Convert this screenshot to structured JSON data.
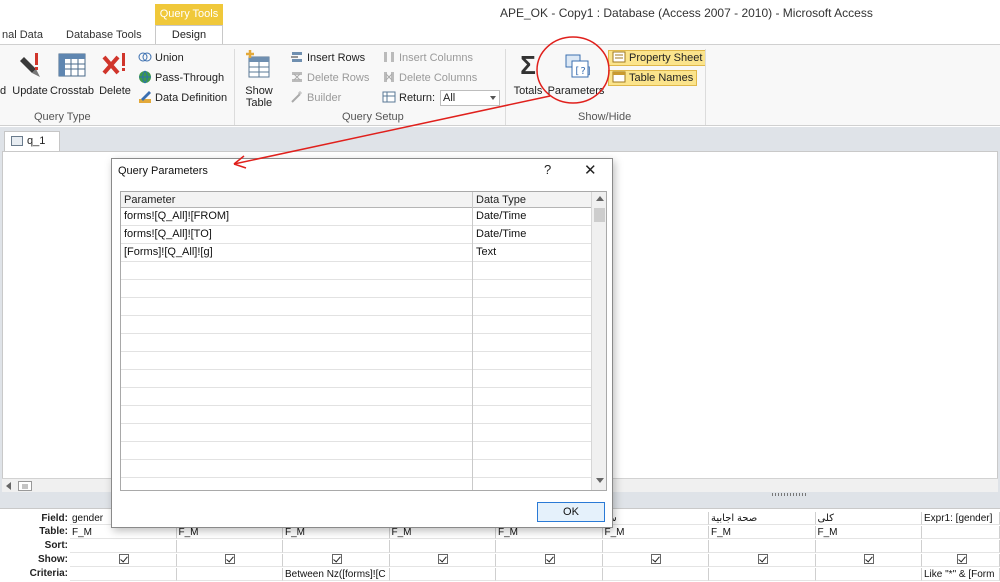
{
  "window": {
    "title": "APE_OK - Copy1 : Database (Access 2007 - 2010)  -  Microsoft Access"
  },
  "ribbon_tabs": {
    "context_label": "Query Tools",
    "external": "nal Data",
    "dbtools": "Database Tools",
    "design": "Design"
  },
  "ribbon": {
    "query_type": {
      "label": "Query Type",
      "update": "Update",
      "crosstab": "Crosstab",
      "delete": "Delete",
      "partial_left": "d",
      "union": "Union",
      "pass_through": "Pass-Through",
      "data_definition": "Data Definition"
    },
    "query_setup": {
      "label": "Query Setup",
      "show_table": [
        "Show",
        "Table"
      ],
      "insert_rows": "Insert Rows",
      "delete_rows": "Delete Rows",
      "builder": "Builder",
      "insert_columns": "Insert Columns",
      "delete_columns": "Delete Columns",
      "return_label": "Return:",
      "return_value": "All"
    },
    "show_hide": {
      "label": "Show/Hide",
      "totals": "Totals",
      "parameters": "Parameters",
      "property_sheet": "Property Sheet",
      "table_names": "Table Names"
    }
  },
  "document": {
    "tab_label": "q_1"
  },
  "qbe": {
    "row_labels": {
      "field": "Field:",
      "table": "Table:",
      "sort": "Sort:",
      "show": "Show:",
      "criteria": "Criteria:"
    },
    "columns": [
      {
        "field": "gender",
        "table": "F_M",
        "criteria": ""
      },
      {
        "field": "",
        "table": "F_M",
        "criteria": ""
      },
      {
        "field": "",
        "table": "F_M",
        "criteria": "Between Nz([forms]![C"
      },
      {
        "field": "",
        "table": "F_M",
        "criteria": ""
      },
      {
        "field": "",
        "table": "F_M",
        "criteria": ""
      },
      {
        "field": "س",
        "table": "F_M",
        "criteria": ""
      },
      {
        "field": "صحة اجابية",
        "table": "F_M",
        "criteria": ""
      },
      {
        "field": "كلى",
        "table": "F_M",
        "criteria": ""
      },
      {
        "field": "Expr1: [gender]",
        "table": "",
        "criteria": "Like \"*\" & [Form"
      }
    ]
  },
  "dialog": {
    "title": "Query Parameters",
    "help": "?",
    "close": "✕",
    "columns": [
      "Parameter",
      "Data Type"
    ],
    "rows": [
      {
        "parameter": "forms![Q_All]![FROM]",
        "type": "Date/Time"
      },
      {
        "parameter": "forms![Q_All]![TO]",
        "type": "Date/Time"
      },
      {
        "parameter": "[Forms]![Q_All]![g]",
        "type": "Text"
      }
    ],
    "empty_rows": 14,
    "ok_label": "OK"
  },
  "colors": {
    "accent": "#f0c83a",
    "annotation": "#e0201c",
    "ok_border": "#2a7ad6"
  }
}
